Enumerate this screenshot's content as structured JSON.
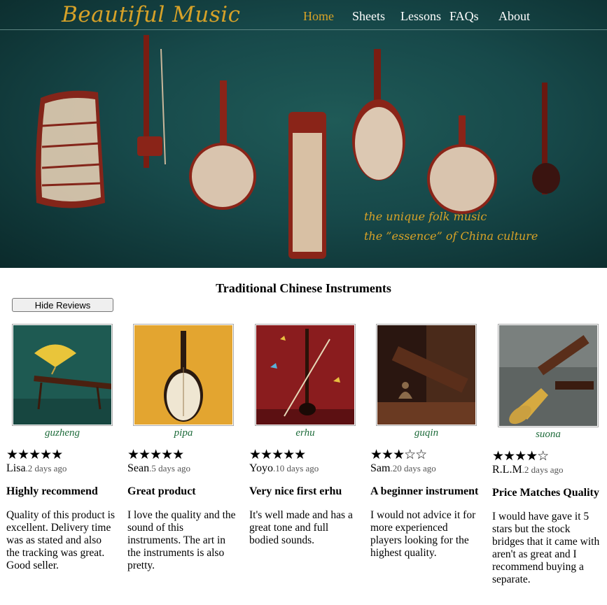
{
  "site": {
    "logo": "Beautiful Music",
    "nav": [
      {
        "label": "Home",
        "active": true
      },
      {
        "label": "Sheets",
        "active": false
      },
      {
        "label": "Lessons",
        "active": false
      },
      {
        "label": "FAQs",
        "active": false
      },
      {
        "label": "About",
        "active": false
      }
    ],
    "tagline": [
      "the unique folk music",
      "the ”essence” of China culture"
    ]
  },
  "section": {
    "title": "Traditional Chinese Instruments",
    "hide_button": "Hide Reviews"
  },
  "products": [
    {
      "name": "guzheng",
      "stars": "★★★★★",
      "rating": 5,
      "reviewer": "Lisa",
      "ago": ".2 days ago",
      "title": "Highly recommend",
      "body": "Quality of this product is excellent. Delivery time was as stated and also the tracking was great. Good seller."
    },
    {
      "name": "pipa",
      "stars": "★★★★★",
      "rating": 5,
      "reviewer": "Sean",
      "ago": ".5 days ago",
      "title": "Great product",
      "body": "I love the quality and the sound of this instruments. The art in the instruments is also pretty."
    },
    {
      "name": "erhu",
      "stars": "★★★★★",
      "rating": 5,
      "reviewer": "Yoyo",
      "ago": ".10 days ago",
      "title": "Very nice first erhu",
      "body": "It's well made and has a great tone and full bodied sounds."
    },
    {
      "name": "guqin",
      "stars": "★★★☆☆",
      "rating": 3,
      "reviewer": "Sam",
      "ago": ".20 days ago",
      "title": "A beginner instrument",
      "body": "I would not advice it for more experienced players looking for the highest quality."
    },
    {
      "name": "suona",
      "stars": "★★★★☆",
      "rating": 4,
      "reviewer": "R.L.M",
      "ago": ".2 days ago",
      "title": "Price Matches Quality",
      "body": "I would have gave it 5 stars but the stock bridges that it came with aren't as great and I recommend buying a separate."
    }
  ],
  "colors": {
    "accent": "#d7a228",
    "hero_bg": "#17494a",
    "name_green": "#1d6b3a"
  }
}
